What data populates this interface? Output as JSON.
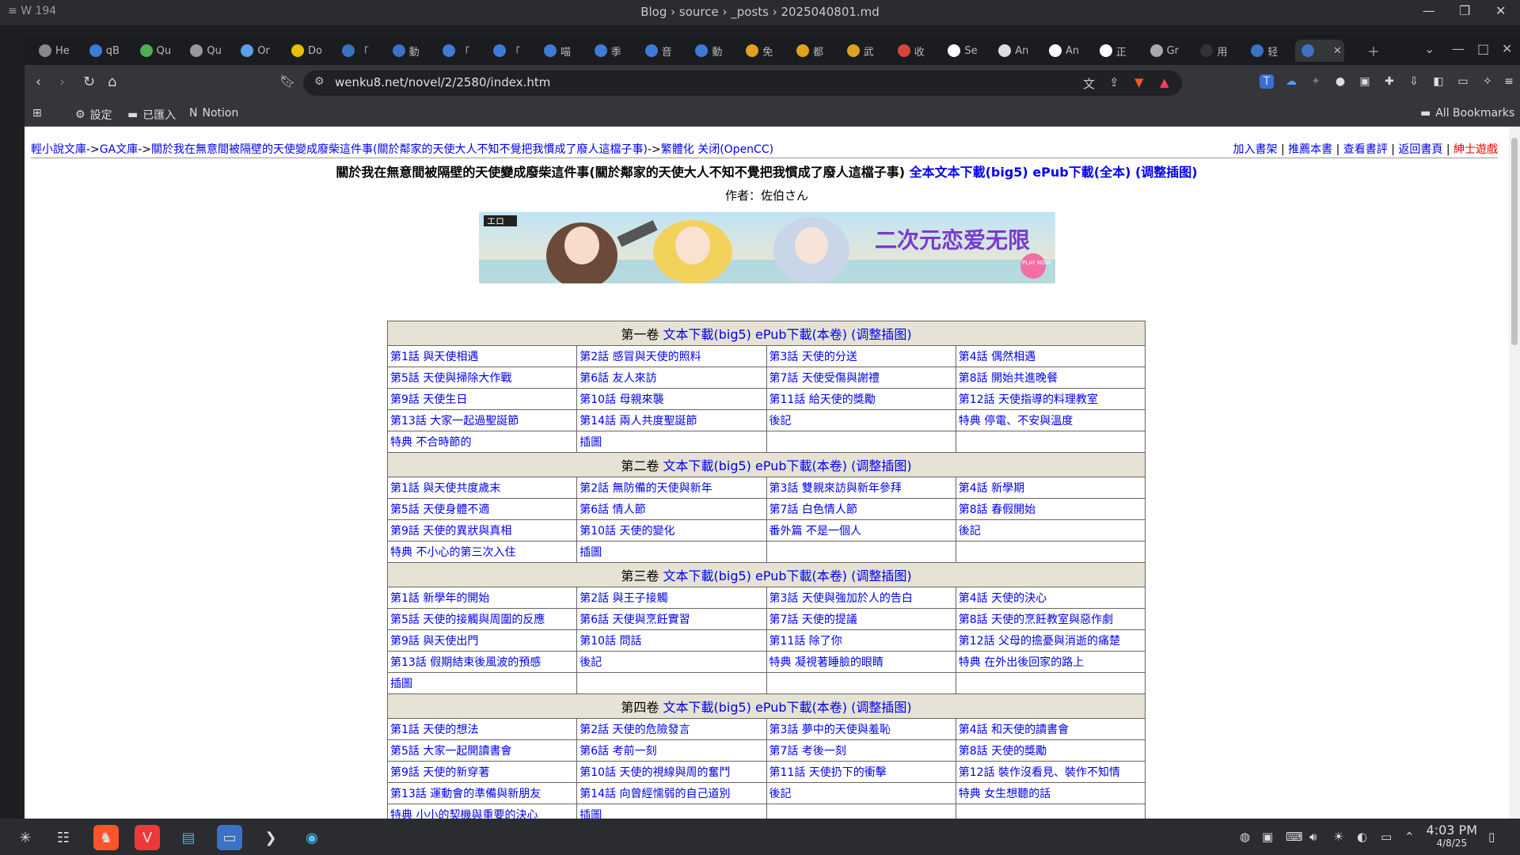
{
  "os": {
    "workspace_label": "W 194",
    "window_title": "Blog › source › _posts › 2025040801.md",
    "clock_time": "4:03 PM",
    "clock_date": "4/8/25"
  },
  "tabs": [
    {
      "label": "He",
      "color": "#888888"
    },
    {
      "label": "qB",
      "color": "#3d7bd9"
    },
    {
      "label": "Qu",
      "color": "#4caf50"
    },
    {
      "label": "Qu",
      "color": "#999999"
    },
    {
      "label": "Or",
      "color": "#5aa0e6"
    },
    {
      "label": "Do",
      "color": "#e8c000"
    },
    {
      "label": "「",
      "color": "#3a72c4"
    },
    {
      "label": "動",
      "color": "#3a72c4"
    },
    {
      "label": "「",
      "color": "#3d7bd9"
    },
    {
      "label": "「",
      "color": "#3d7bd9"
    },
    {
      "label": "喵",
      "color": "#3d7bd9"
    },
    {
      "label": "季",
      "color": "#3d7bd9"
    },
    {
      "label": "音",
      "color": "#3d7bd9"
    },
    {
      "label": "動",
      "color": "#3d7bd9"
    },
    {
      "label": "免",
      "color": "#e0a020"
    },
    {
      "label": "都",
      "color": "#e0a020"
    },
    {
      "label": "武",
      "color": "#e0a020"
    },
    {
      "label": "收",
      "color": "#d44638"
    },
    {
      "label": "Se",
      "color": "#ffffff"
    },
    {
      "label": "An",
      "color": "#dddddd"
    },
    {
      "label": "An",
      "color": "#ffffff"
    },
    {
      "label": "正",
      "color": "#ffffff"
    },
    {
      "label": "Gr",
      "color": "#aaaaaa"
    },
    {
      "label": "用",
      "color": "#333333"
    },
    {
      "label": "轻",
      "color": "#3a72c4"
    },
    {
      "label": "",
      "color": "#3a72c4",
      "active": true
    }
  ],
  "navbar": {
    "url": "wenku8.net/novel/2/2580/index.htm"
  },
  "bookmarks": {
    "settings": "設定",
    "imported": "已匯入",
    "notion": "Notion",
    "all": "All Bookmarks"
  },
  "page": {
    "crumb_home": "輕小說文庫",
    "crumb_ga": "GA文庫",
    "crumb_title": "關於我在無意間被隔壁的天使變成廢柴這件事(關於鄰家的天使大人不知不覺把我慣成了廢人這檔子事)",
    "crumb_trad": "繁體化",
    "crumb_close": "关闭(OpenCC)",
    "nav_add": "加入書架",
    "nav_recommend": "推薦本書",
    "nav_review": "查看書評",
    "nav_back": "返回書頁",
    "nav_game": "紳士遊戲",
    "title": "關於我在無意間被隔壁的天使變成廢柴這件事(關於鄰家的天使大人不知不覺把我慣成了廢人這檔子事)",
    "dl_full": "全本文本下載(big5)",
    "dl_epub_full": "ePub下載(全本)",
    "dl_fix": "(调整插图)",
    "author": "作者：佐伯さん",
    "banner_text": "二次元恋爱无限",
    "banner_badge": "エロ",
    "banner_play": "PLAY NOW",
    "vol_links": {
      "txt": "文本下載(big5)",
      "epub": "ePub下載(本卷)",
      "fix": "(调整插图)"
    }
  },
  "volumes": [
    {
      "name": "第一卷",
      "chapters": [
        "第1話 與天使相遇",
        "第2話 感冒與天使的照料",
        "第3話 天使的分送",
        "第4話 偶然相遇",
        "第5話 天使與掃除大作戰",
        "第6話 友人來訪",
        "第7話 天使受傷與謝禮",
        "第8話 開始共進晚餐",
        "第9話 天使生日",
        "第10話 母親來襲",
        "第11話 給天使的獎勵",
        "第12話 天使指導的料理教室",
        "第13話 大家一起過聖誕節",
        "第14話 兩人共度聖誕節",
        "後記",
        "特典 停電、不安與溫度",
        "特典 不合時節的",
        "插圖",
        "",
        ""
      ]
    },
    {
      "name": "第二卷",
      "chapters": [
        "第1話 與天使共度歲末",
        "第2話 無防備的天使與新年",
        "第3話 雙親來訪與新年參拜",
        "第4話 新學期",
        "第5話 天使身體不適",
        "第6話 情人節",
        "第7話 白色情人節",
        "第8話 春假開始",
        "第9話 天使的異狀與真相",
        "第10話 天使的變化",
        "番外篇 不是一個人",
        "後記",
        "特典 不小心的第三次入住",
        "插圖",
        "",
        ""
      ]
    },
    {
      "name": "第三卷",
      "chapters": [
        "第1話 新學年的開始",
        "第2話 與王子接觸",
        "第3話 天使與強加於人的告白",
        "第4話 天使的決心",
        "第5話 天使的接觸與周圍的反應",
        "第6話 天使與烹飪實習",
        "第7話 天使的提議",
        "第8話 天使的烹飪教室與惡作劇",
        "第9話 與天使出門",
        "第10話 問話",
        "第11話 除了你",
        "第12話 父母的擔憂與消逝的痛楚",
        "第13話 假期結束後風波的預感",
        "後記",
        "特典 凝視著睡臉的眼睛",
        "特典 在外出後回家的路上",
        "插圖",
        "",
        "",
        ""
      ]
    },
    {
      "name": "第四卷",
      "chapters": [
        "第1話 天使的想法",
        "第2話 天使的危險發言",
        "第3話 夢中的天使與羞恥",
        "第4話 和天使的讀書會",
        "第5話 大家一起開讀書會",
        "第6話 考前一刻",
        "第7話 考後一刻",
        "第8話 天使的獎勵",
        "第9話 天使的新穿著",
        "第10話 天使的視線與周的奮鬥",
        "第11話 天使扔下的衝擊",
        "第12話 裝作沒看見、裝作不知情",
        "第13話 運動會的準備與新朋友",
        "第14話 向曾經懦弱的自己道別",
        "後記",
        "特典 女生想聽的話",
        "特典 小小的契機與重要的決心",
        "插圖",
        "",
        ""
      ]
    }
  ]
}
